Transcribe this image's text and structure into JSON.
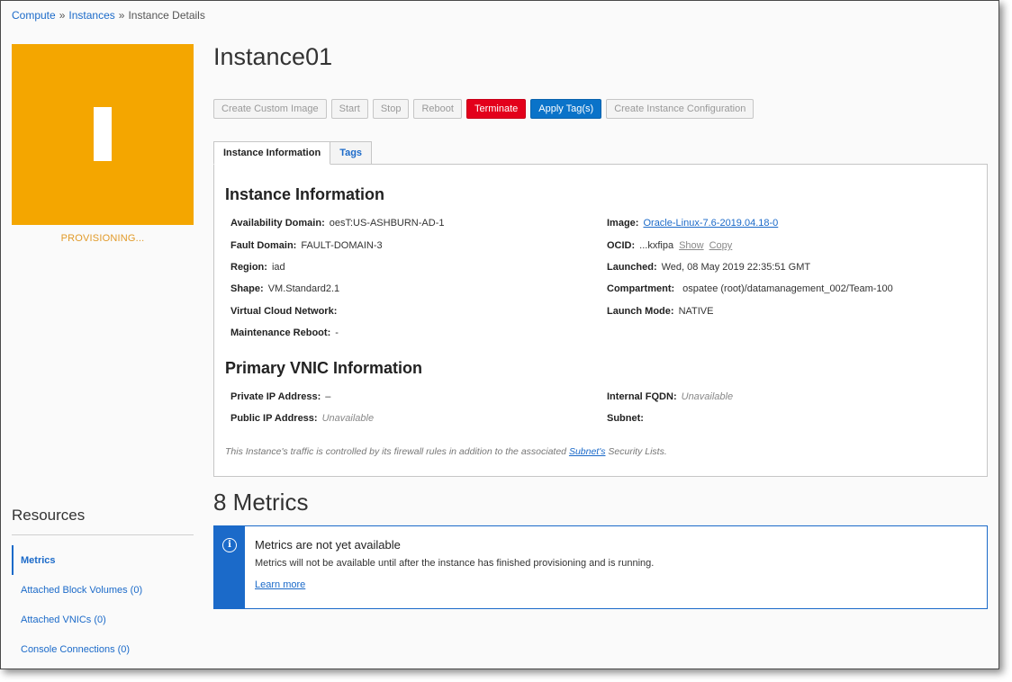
{
  "breadcrumb": {
    "compute": "Compute",
    "instances": "Instances",
    "current": "Instance Details",
    "separator": "»"
  },
  "avatar": {
    "glyph": "I",
    "color": "#f4a600"
  },
  "status": "PROVISIONING...",
  "page_title": "Instance01",
  "toolbar": {
    "create_custom_image": "Create Custom Image",
    "start": "Start",
    "stop": "Stop",
    "reboot": "Reboot",
    "terminate": "Terminate",
    "apply_tags": "Apply Tag(s)",
    "create_instance_config": "Create Instance Configuration"
  },
  "tabs": {
    "instance_info": "Instance Information",
    "tags": "Tags"
  },
  "instance_info": {
    "heading": "Instance Information",
    "availability_domain": {
      "label": "Availability Domain:",
      "value": "oesT:US-ASHBURN-AD-1"
    },
    "fault_domain": {
      "label": "Fault Domain:",
      "value": "FAULT-DOMAIN-3"
    },
    "region": {
      "label": "Region:",
      "value": "iad"
    },
    "shape": {
      "label": "Shape:",
      "value": "VM.Standard2.1"
    },
    "vcn": {
      "label": "Virtual Cloud Network:",
      "value": ""
    },
    "maintenance_reboot": {
      "label": "Maintenance Reboot:",
      "value": "-"
    },
    "image": {
      "label": "Image:",
      "value": "Oracle-Linux-7.6-2019.04.18-0"
    },
    "ocid": {
      "label": "OCID:",
      "value": "...kxfipa",
      "show": "Show",
      "copy": "Copy"
    },
    "launched": {
      "label": "Launched:",
      "value": "Wed, 08 May 2019 22:35:51 GMT"
    },
    "compartment": {
      "label": "Compartment:",
      "value": "ospatee (root)/datamanagement_002/Team-100"
    },
    "launch_mode": {
      "label": "Launch Mode:",
      "value": "NATIVE"
    }
  },
  "vnic_info": {
    "heading": "Primary VNIC Information",
    "private_ip": {
      "label": "Private IP Address:",
      "value": "–"
    },
    "public_ip": {
      "label": "Public IP Address:",
      "value": "Unavailable"
    },
    "internal_fqdn": {
      "label": "Internal FQDN:",
      "value": "Unavailable"
    },
    "subnet": {
      "label": "Subnet:",
      "value": ""
    },
    "note_prefix": "This Instance's traffic is controlled by its firewall rules in addition to the associated ",
    "note_link": "Subnet's",
    "note_suffix": " Security Lists."
  },
  "metrics": {
    "title": "8 Metrics",
    "alert_title": "Metrics are not yet available",
    "alert_body": "Metrics will not be available until after the instance has finished provisioning and is running.",
    "alert_link": "Learn more"
  },
  "resources": {
    "title": "Resources",
    "items": [
      {
        "label": "Metrics"
      },
      {
        "label": "Attached Block Volumes (0)"
      },
      {
        "label": "Attached VNICs (0)"
      },
      {
        "label": "Console Connections (0)"
      }
    ]
  },
  "colors": {
    "link": "#1b6ac9",
    "terminate": "#e3001b",
    "primary": "#0a73c9",
    "provisioning": "#e19a29"
  }
}
